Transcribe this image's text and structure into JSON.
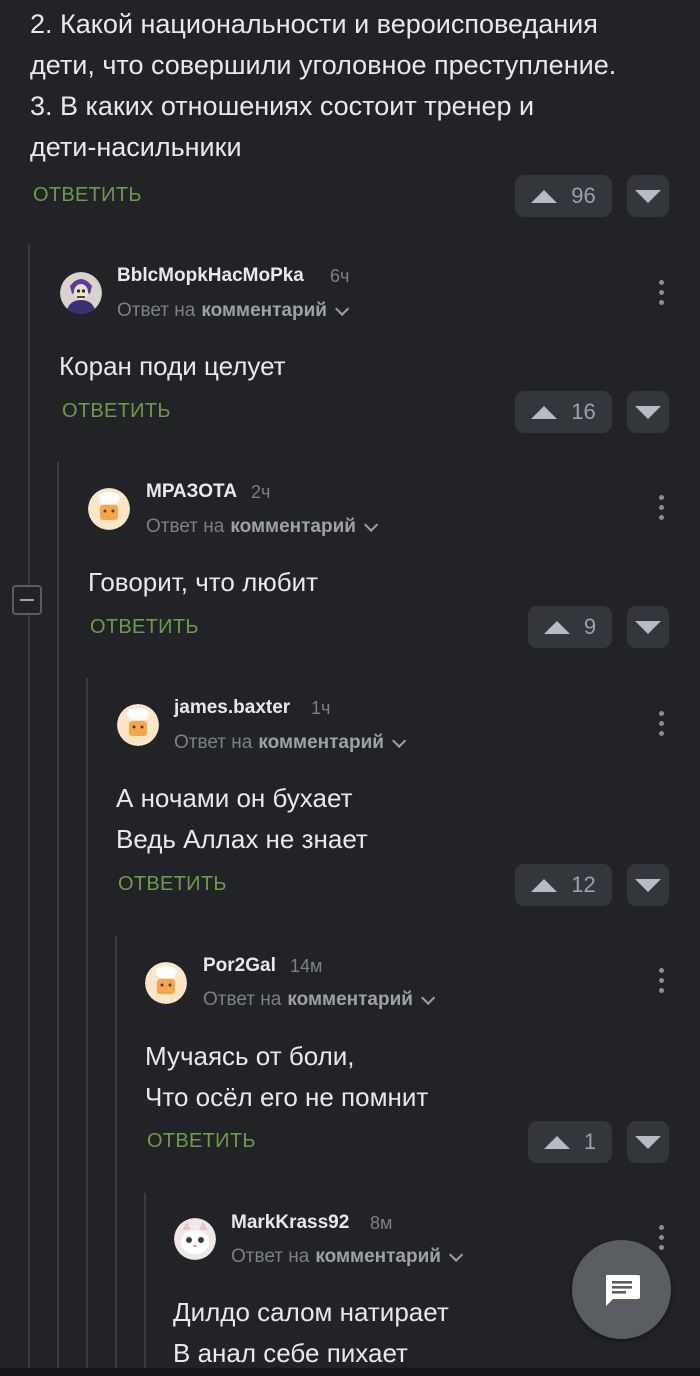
{
  "top_comment": {
    "lines": [
      "2. Какой национальности и вероисповедания",
      "дети, что совершили уголовное преступление.",
      "3. В каких отношениях состоит тренер и",
      "дети-насильники"
    ],
    "reply_label": "ОТВЕТИТЬ",
    "votes": "96"
  },
  "comments": [
    {
      "username": "BblcMopkHacMoPka",
      "time": "6ч",
      "reply_prefix": "Ответ на",
      "reply_link": "комментарий",
      "lines": [
        "Коран поди целует"
      ],
      "reply_label": "ОТВЕТИТЬ",
      "votes": "16",
      "avatar_icon": "skeletor-avatar"
    },
    {
      "username": "МРАЗОТА",
      "time": "2ч",
      "reply_prefix": "Ответ на",
      "reply_link": "комментарий",
      "lines": [
        "Говорит, что любит"
      ],
      "reply_label": "ОТВЕТИТЬ",
      "votes": "9",
      "avatar_icon": "chef-avatar"
    },
    {
      "username": "james.baxter",
      "time": "1ч",
      "reply_prefix": "Ответ на",
      "reply_link": "комментарий",
      "lines": [
        "А ночами он бухает",
        "Ведь Аллах не знает"
      ],
      "reply_label": "ОТВЕТИТЬ",
      "votes": "12",
      "avatar_icon": "chef-avatar"
    },
    {
      "username": "Por2Gal",
      "time": "14м",
      "reply_prefix": "Ответ на",
      "reply_link": "комментарий",
      "lines": [
        "Мучаясь от боли,",
        "Что осёл его не помнит"
      ],
      "reply_label": "ОТВЕТИТЬ",
      "votes": "1",
      "avatar_icon": "chef-avatar"
    },
    {
      "username": "MarkKrass92",
      "time": "8м",
      "reply_prefix": "Ответ на",
      "reply_link": "комментарий",
      "lines": [
        "Дилдо салом натирает",
        "В анал себе пихает"
      ],
      "avatar_icon": "cat-avatar"
    }
  ],
  "colors": {
    "background": "#212326",
    "accent_green": "#6f9a4d",
    "button_bg": "#33363b"
  },
  "fab_icon": "comment-icon"
}
